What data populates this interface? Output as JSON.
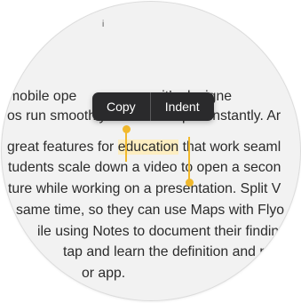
{
  "top_fragment": "i",
  "lines": [
    {
      "parts": [
        {
          "text": "mobile ope",
          "sel": false
        },
        {
          "text": "it’s designe",
          "sel": false
        }
      ]
    },
    {
      "parts": [
        {
          "text": "os run smoothly. Websites open instantly. Ar",
          "sel": false
        }
      ]
    },
    {
      "parts": [
        {
          "text": "great features for ",
          "sel": false
        },
        {
          "text": "education",
          "sel": true
        },
        {
          "text": " that work seaml",
          "sel": false
        }
      ]
    },
    {
      "parts": [
        {
          "text": "tudents scale down a video to open a secon",
          "sel": false
        }
      ]
    },
    {
      "parts": [
        {
          "text": "ture while working on a presentation. Split V",
          "sel": false
        }
      ]
    },
    {
      "parts": [
        {
          "text": "same time, so they can use Maps with Flyo",
          "sel": false
        }
      ]
    },
    {
      "parts": [
        {
          "text": "ile using Notes to document their finding",
          "sel": false
        }
      ]
    },
    {
      "parts": [
        {
          "text": "tap and learn the definition and pron",
          "sel": false
        }
      ]
    },
    {
      "parts": [
        {
          "text": "or app.",
          "sel": false
        }
      ]
    }
  ],
  "menu": {
    "copy_label": "Copy",
    "indent_label": "Indent"
  },
  "colors": {
    "selection_highlight": "#fdeec1",
    "selection_handle": "#f1b92e",
    "menu_background": "#2a2a2c"
  }
}
